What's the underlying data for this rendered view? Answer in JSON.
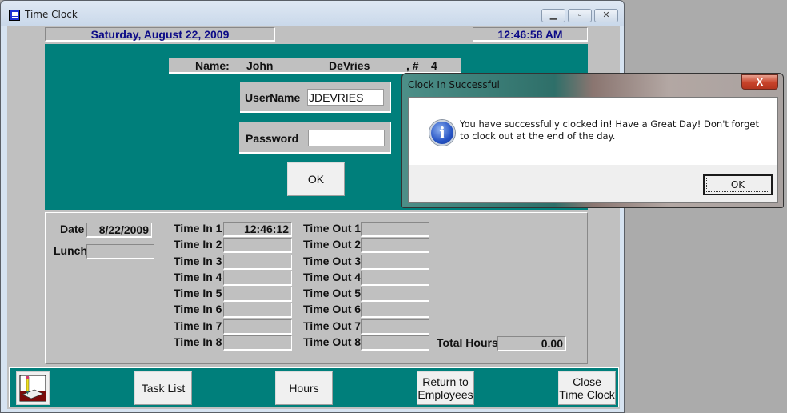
{
  "window": {
    "title": "Time Clock",
    "app_icon": "form-list-icon",
    "controls": {
      "minimize": "minimize-icon",
      "maximize": "maximize-icon",
      "close": "close-icon"
    }
  },
  "header": {
    "date": "Saturday, August 22, 2009",
    "time": "12:46:58 AM"
  },
  "employee": {
    "name_label": "Name:",
    "first_name": "John",
    "last_name": "DeVries",
    "number_label": ", #",
    "number": "4"
  },
  "login": {
    "username_label": "UserName",
    "username_value": "JDEVRIES",
    "password_label": "Password",
    "password_value": "",
    "ok_label": "OK"
  },
  "timesheet": {
    "date_label": "Date",
    "date_value": "8/22/2009",
    "lunch_label": "Lunch",
    "lunch_value": "",
    "time_in": [
      {
        "label": "Time In 1",
        "value": "12:46:12 AM"
      },
      {
        "label": "Time In 2",
        "value": ""
      },
      {
        "label": "Time In 3",
        "value": ""
      },
      {
        "label": "Time In 4",
        "value": ""
      },
      {
        "label": "Time In 5",
        "value": ""
      },
      {
        "label": "Time In 6",
        "value": ""
      },
      {
        "label": "Time In 7",
        "value": ""
      },
      {
        "label": "Time In 8",
        "value": ""
      }
    ],
    "time_out": [
      {
        "label": "Time Out 1",
        "value": ""
      },
      {
        "label": "Time Out 2",
        "value": ""
      },
      {
        "label": "Time Out 3",
        "value": ""
      },
      {
        "label": "Time Out 4",
        "value": ""
      },
      {
        "label": "Time Out 5",
        "value": ""
      },
      {
        "label": "Time Out 6",
        "value": ""
      },
      {
        "label": "Time Out 7",
        "value": ""
      },
      {
        "label": "Time Out 8",
        "value": ""
      }
    ],
    "total_hours_label": "Total Hours",
    "total_hours_value": "0.00"
  },
  "toolbar": {
    "logo_icon": "pencil-notepad-icon",
    "task_list_label": "Task List",
    "hours_label": "Hours",
    "return_label_line1": "Return to",
    "return_label_line2": "Employees",
    "close_label_line1": "Close",
    "close_label_line2": "Time Clock"
  },
  "dialog": {
    "title": "Clock In Successful",
    "close_glyph": "X",
    "icon": "info-icon",
    "icon_glyph": "i",
    "message": "You have successfully clocked in!  Have a Great Day!  Don't forget to clock out at the end of the day.",
    "ok_label": "OK"
  },
  "colors": {
    "teal": "#007f7b",
    "form_gray": "#c0c0c0",
    "header_text": "#0d0b87"
  }
}
